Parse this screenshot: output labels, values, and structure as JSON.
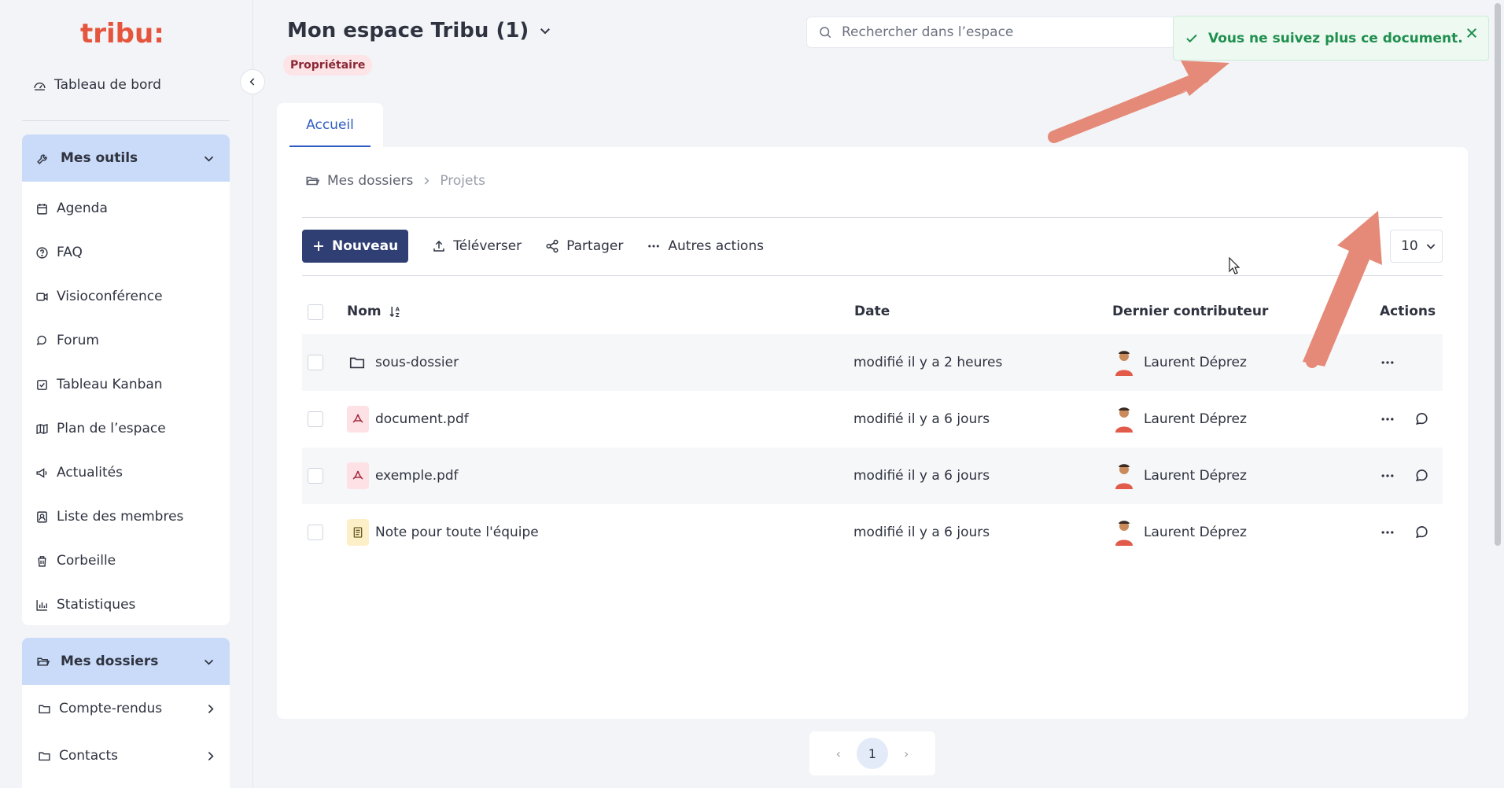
{
  "sidebar": {
    "logo_text": "tribu:",
    "dashboard_label": "Tableau de bord",
    "tools_header": "Mes outils",
    "tools": [
      {
        "label": "Agenda",
        "icon": "calendar-icon"
      },
      {
        "label": "FAQ",
        "icon": "question-icon"
      },
      {
        "label": "Visioconférence",
        "icon": "video-icon"
      },
      {
        "label": "Forum",
        "icon": "forum-icon"
      },
      {
        "label": "Tableau Kanban",
        "icon": "kanban-icon"
      },
      {
        "label": "Plan de l’espace",
        "icon": "map-icon"
      },
      {
        "label": "Actualités",
        "icon": "megaphone-icon"
      },
      {
        "label": "Liste des membres",
        "icon": "members-icon"
      },
      {
        "label": "Corbeille",
        "icon": "trash-icon"
      },
      {
        "label": "Statistiques",
        "icon": "stats-icon"
      }
    ],
    "folders_header": "Mes dossiers",
    "folders": [
      {
        "label": "Compte-rendus"
      },
      {
        "label": "Contacts"
      }
    ]
  },
  "header": {
    "space_title": "Mon espace Tribu (1)",
    "role_badge": "Propriétaire",
    "search_placeholder": "Rechercher dans l’espace"
  },
  "toast": {
    "message": "Vous ne suivez plus ce document."
  },
  "tabs": [
    {
      "label": "Accueil"
    }
  ],
  "breadcrumb": {
    "root": "Mes dossiers",
    "current": "Projets"
  },
  "toolbar": {
    "new_label": "Nouveau",
    "upload_label": "Téléverser",
    "share_label": "Partager",
    "more_label": "Autres actions",
    "per_page": "10"
  },
  "table": {
    "columns": {
      "name": "Nom",
      "date": "Date",
      "contributor": "Dernier contributeur",
      "actions": "Actions"
    },
    "rows": [
      {
        "name": "sous-dossier",
        "type": "folder",
        "date": "modifié il y a 2 heures",
        "contributor": "Laurent Déprez"
      },
      {
        "name": "document.pdf",
        "type": "pdf",
        "date": "modifié il y a 6 jours",
        "contributor": "Laurent Déprez"
      },
      {
        "name": "exemple.pdf",
        "type": "pdf",
        "date": "modifié il y a 6 jours",
        "contributor": "Laurent Déprez"
      },
      {
        "name": "Note pour toute l'équipe",
        "type": "note",
        "date": "modifié il y a 6 jours",
        "contributor": "Laurent Déprez"
      }
    ]
  },
  "pagination": {
    "current_page": "1",
    "prev": "‹",
    "next": "›"
  },
  "colors": {
    "primary": "#2f3e73",
    "accent_blue": "#2f5cc3",
    "sidebar_header": "#c9dbf8",
    "toast_green": "#1f8f4e",
    "annotation_arrow": "#e58a78"
  }
}
